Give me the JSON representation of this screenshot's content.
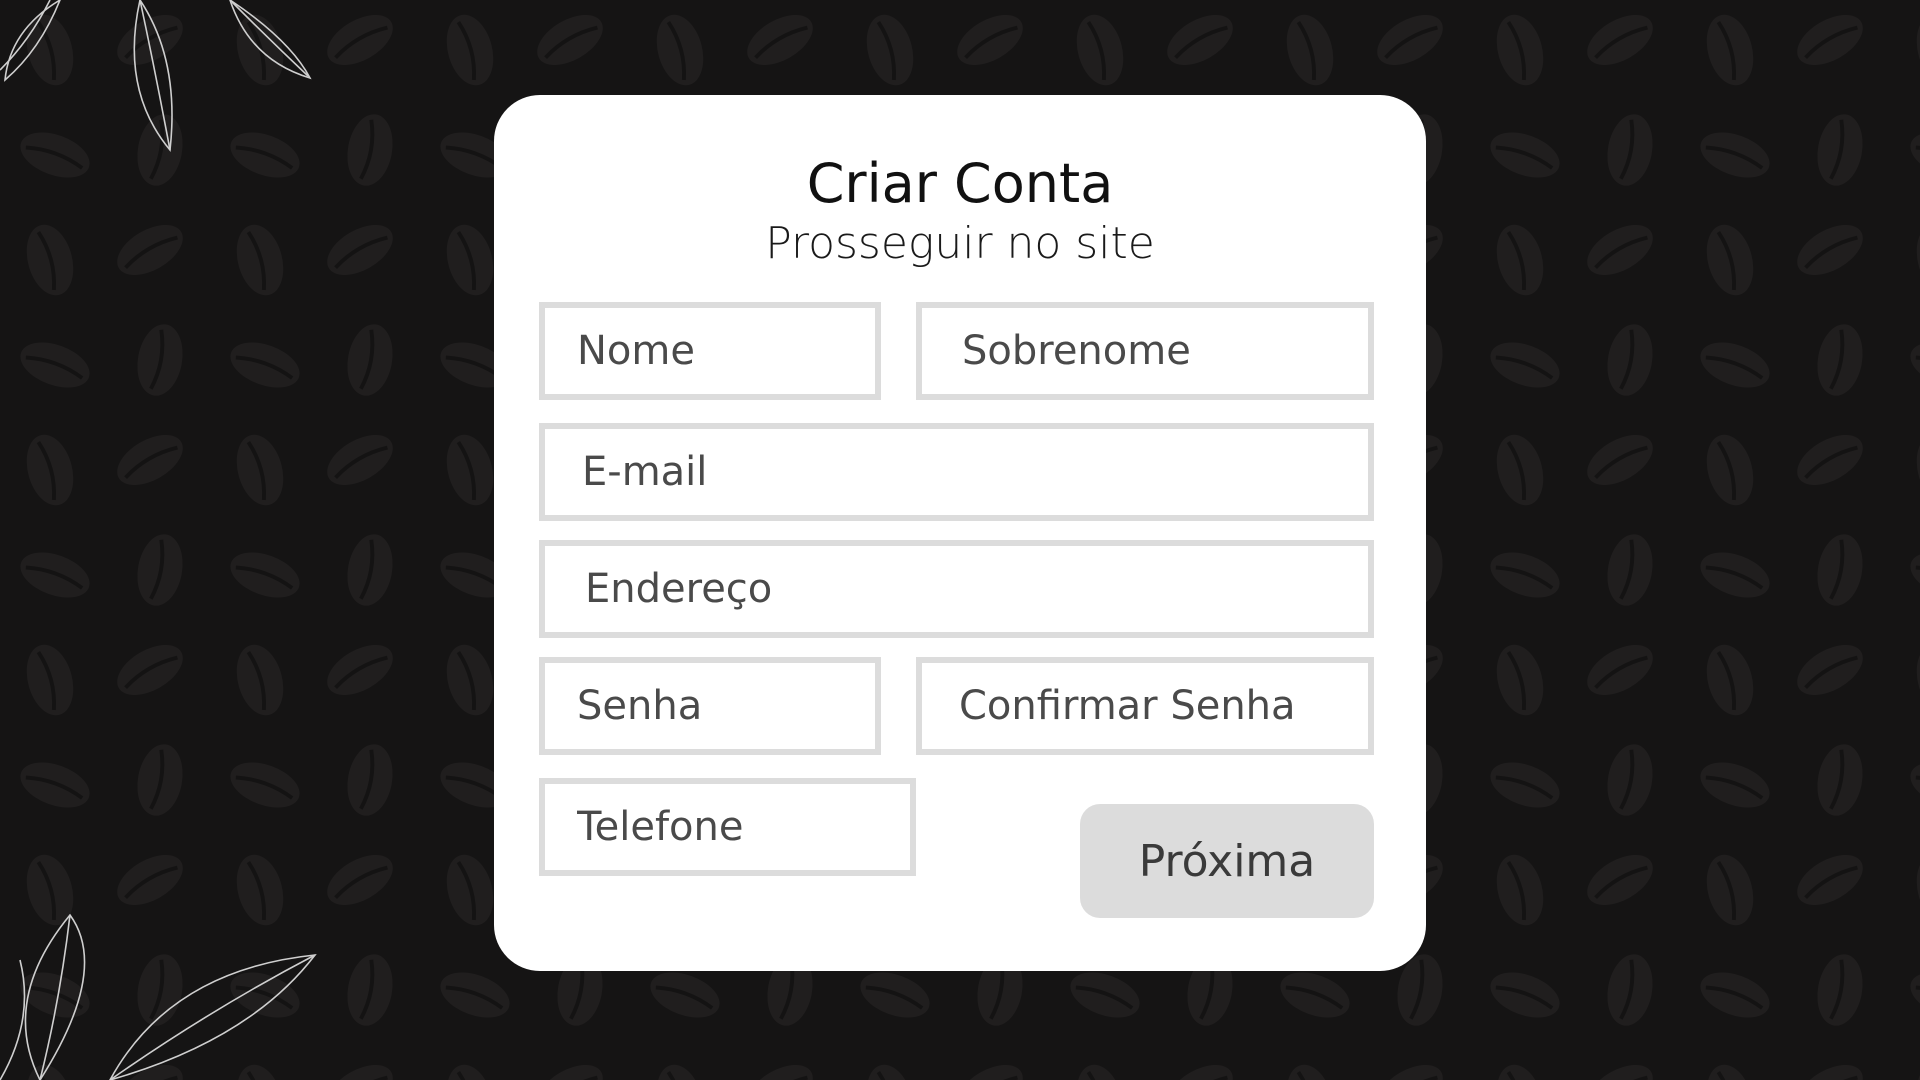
{
  "form": {
    "title": "Criar Conta",
    "subtitle": "Prosseguir no site",
    "fields": {
      "first_name": "Nome",
      "last_name": "Sobrenome",
      "email": "E-mail",
      "address": "Endereço",
      "password": "Senha",
      "confirm_password": "Confirmar Senha",
      "phone": "Telefone"
    },
    "next_label": "Próxima"
  },
  "colors": {
    "background": "#151414",
    "card": "#ffffff",
    "field_border": "#dcdcdc",
    "button": "#dcdcdc"
  },
  "decorations": {
    "pattern": "coffee-bean-pattern",
    "top_left": "leaf-illustration",
    "bottom_left": "leaf-illustration"
  }
}
